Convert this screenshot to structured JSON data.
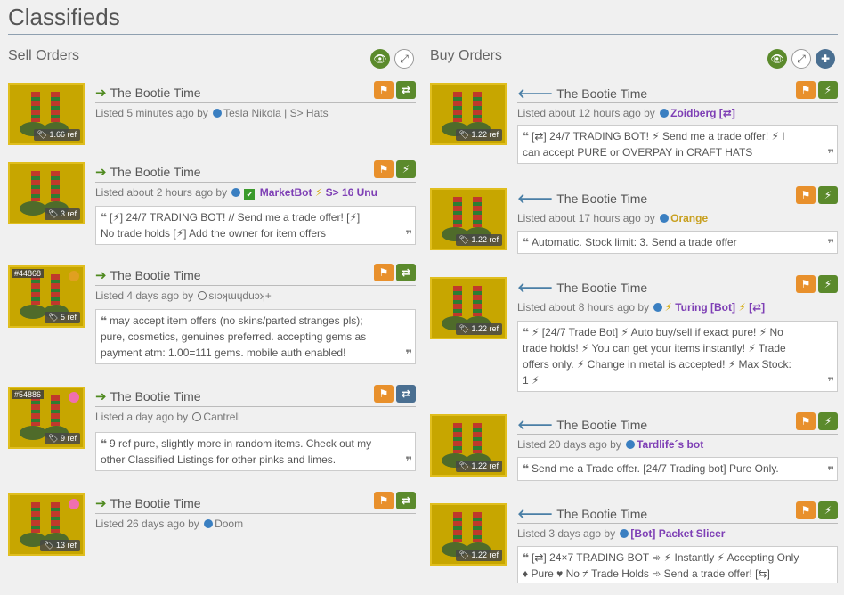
{
  "page_title": "Classifieds",
  "sell": {
    "title": "Sell Orders",
    "listings": [
      {
        "name": "The Bootie Time",
        "price": "1.66 ref",
        "time": "Listed 5 minutes ago by",
        "user": "Tesla Nikola | S> Hats",
        "comment": ""
      },
      {
        "name": "The Bootie Time",
        "price": "3 ref",
        "time": "Listed about 2 hours ago by",
        "user": "MarketBot",
        "user_extra": "S> 16 Unu",
        "comment_l1": "[⚡] 24/7 TRADING BOT! // Send me a trade offer! [⚡]",
        "comment_l2": "No trade holds [⚡] Add the owner for item offers"
      },
      {
        "name": "The Bootie Time",
        "price": "5 ref",
        "id": "#44868",
        "time": "Listed 4 days ago by",
        "user": "sıɔʞɯɥduɔʞ+",
        "comment_l1": "may accept item offers (no skins/parted stranges pls);",
        "comment_l2": "pure, cosmetics, genuines preferred. accepting gems as",
        "comment_l3": "payment atm: 1.00=111 gems. mobile auth enabled!"
      },
      {
        "name": "The Bootie Time",
        "price": "9 ref",
        "id": "#54886",
        "time": "Listed a day ago by",
        "user": "Cantrell",
        "comment_l1": "9 ref pure, slightly more in random items. Check out my",
        "comment_l2": "other Classified Listings for other pinks and limes."
      },
      {
        "name": "The Bootie Time",
        "price": "13 ref",
        "time": "Listed 26 days ago by",
        "user": "Doom"
      }
    ]
  },
  "buy": {
    "title": "Buy Orders",
    "listings": [
      {
        "name": "The Bootie Time",
        "price": "1.22 ref",
        "time": "Listed about 12 hours ago by",
        "user": "Zoidberg [⇄]",
        "comment_l1": "[⇄] 24/7 TRADING BOT! ⚡ Send me a trade offer! ⚡ I",
        "comment_l2": "can accept PURE or OVERPAY in CRAFT HATS"
      },
      {
        "name": "The Bootie Time",
        "price": "1.22 ref",
        "time": "Listed about 17 hours ago by",
        "user": "Orange",
        "comment_l1": "Automatic. Stock limit: 3. Send a trade offer"
      },
      {
        "name": "The Bootie Time",
        "price": "1.22 ref",
        "time": "Listed about 8 hours ago by",
        "user": "Turing [Bot]",
        "user_extra": "[⇄]",
        "comment_l1": "⚡ [24/7 Trade Bot] ⚡ Auto buy/sell if exact pure! ⚡ No",
        "comment_l2": "trade holds! ⚡ You can get your items instantly! ⚡ Trade",
        "comment_l3": "offers only. ⚡ Change in metal is accepted! ⚡ Max Stock:",
        "comment_l4": "1 ⚡"
      },
      {
        "name": "The Bootie Time",
        "price": "1.22 ref",
        "time": "Listed 20 days ago by",
        "user": "Tardlife´s bot",
        "comment_l1": "Send me a Trade offer. [24/7 Trading bot] Pure Only."
      },
      {
        "name": "The Bootie Time",
        "price": "1.22 ref",
        "time": "Listed 3 days ago by",
        "user": "[Bot] Packet Slicer",
        "comment_l1": "[⇄] 24×7 TRADING BOT ➾ ⚡ Instantly ⚡ Accepting Only",
        "comment_l2": "♦ Pure ♥ No ≠ Trade Holds ➾ Send a trade offer! [⇆]"
      }
    ]
  },
  "icons": {
    "flag": "flag-icon",
    "swap": "swap-icon",
    "bolt": "bolt-icon",
    "eye": "eye-icon",
    "expand": "expand-icon",
    "plus": "plus-icon",
    "tag": "tag-icon"
  },
  "colors": {
    "accent_green": "#5b8a2c",
    "accent_orange": "#e8902c",
    "accent_blue": "#4a6f91",
    "thumb_bg": "#c7a600",
    "username_purple": "#7e3fb5"
  }
}
